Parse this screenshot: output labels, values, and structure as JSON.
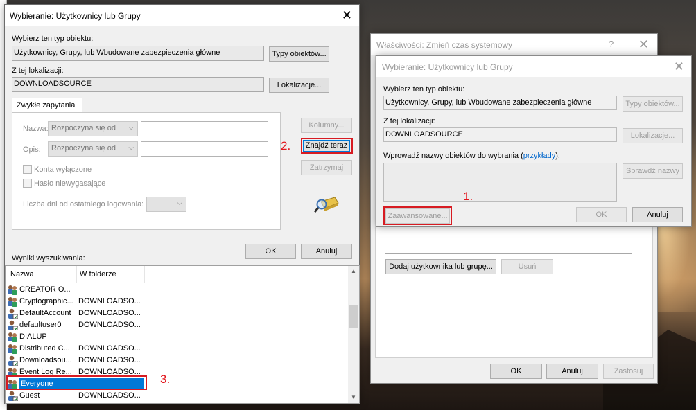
{
  "dialog_main": {
    "title": "Wybieranie: Użytkownicy lub Grupy",
    "object_type_label": "Wybierz ten typ obiektu:",
    "object_type_value": "Użytkownicy, Grupy, lub Wbudowane zabezpieczenia główne",
    "object_types_button": "Typy obiektów...",
    "location_label": "Z tej lokalizacji:",
    "location_value": "DOWNLOADSOURCE",
    "locations_button": "Lokalizacje...",
    "tab_common_queries": "Zwykłe zapytania",
    "name_label": "Nazwa:",
    "name_mode": "Rozpoczyna się od",
    "desc_label": "Opis:",
    "desc_mode": "Rozpoczyna się od",
    "disabled_accounts": "Konta wyłączone",
    "non_expiring_password": "Hasło niewygasające",
    "days_since_logon_label": "Liczba dni od ostatniego logowania:",
    "columns_button": "Kolumny...",
    "find_now_button": "Znajdź teraz",
    "stop_button": "Zatrzymaj",
    "ok_button": "OK",
    "cancel_button": "Anuluj",
    "results_label": "Wyniki wyszukiwania:",
    "col_name": "Nazwa",
    "col_folder": "W folderze",
    "results": [
      {
        "name": "CREATOR O...",
        "folder": "",
        "icon": "group-icon"
      },
      {
        "name": "Cryptographic...",
        "folder": "DOWNLOADSO...",
        "icon": "group-icon"
      },
      {
        "name": "DefaultAccount",
        "folder": "DOWNLOADSO...",
        "icon": "user-icon"
      },
      {
        "name": "defaultuser0",
        "folder": "DOWNLOADSO...",
        "icon": "user-icon"
      },
      {
        "name": "DIALUP",
        "folder": "",
        "icon": "group-icon"
      },
      {
        "name": "Distributed C...",
        "folder": "DOWNLOADSO...",
        "icon": "group-icon"
      },
      {
        "name": "Downloadsou...",
        "folder": "DOWNLOADSO...",
        "icon": "user-icon"
      },
      {
        "name": "Event Log Re...",
        "folder": "DOWNLOADSO...",
        "icon": "group-icon"
      },
      {
        "name": "Everyone",
        "folder": "",
        "icon": "group-icon",
        "selected": true
      },
      {
        "name": "Guest",
        "folder": "DOWNLOADSO...",
        "icon": "user-icon"
      }
    ]
  },
  "annotations": {
    "step1": "1.",
    "step2": "2.",
    "step3": "3."
  },
  "dialog_props": {
    "title": "Właściwości: Zmień czas systemowy",
    "help": "?",
    "add_button": "Dodaj użytkownika lub grupę...",
    "remove_button": "Usuń",
    "ok_button": "OK",
    "cancel_button": "Anuluj",
    "apply_button": "Zastosuj"
  },
  "dialog_small": {
    "title": "Wybieranie: Użytkownicy lub Grupy",
    "object_type_label": "Wybierz ten typ obiektu:",
    "object_type_value": "Użytkownicy, Grupy, lub Wbudowane zabezpieczenia główne",
    "object_types_button": "Typy obiektów...",
    "location_label": "Z tej lokalizacji:",
    "location_value": "DOWNLOADSOURCE",
    "locations_button": "Lokalizacje...",
    "enter_names_label": "Wprowadź nazwy obiektów do wybrania (",
    "examples_link": "przykłady",
    "enter_names_suffix": "):",
    "check_names_button": "Sprawdź nazwy",
    "advanced_button": "Zaawansowane...",
    "ok_button": "OK",
    "cancel_button": "Anuluj"
  }
}
